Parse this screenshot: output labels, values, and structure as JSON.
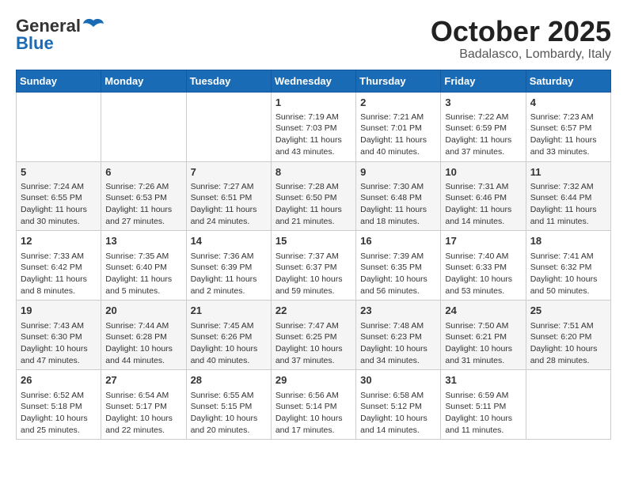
{
  "header": {
    "logo_general": "General",
    "logo_blue": "Blue",
    "month_year": "October 2025",
    "location": "Badalasco, Lombardy, Italy"
  },
  "days_of_week": [
    "Sunday",
    "Monday",
    "Tuesday",
    "Wednesday",
    "Thursday",
    "Friday",
    "Saturday"
  ],
  "weeks": [
    [
      {
        "day": "",
        "sunrise": "",
        "sunset": "",
        "daylight": ""
      },
      {
        "day": "",
        "sunrise": "",
        "sunset": "",
        "daylight": ""
      },
      {
        "day": "",
        "sunrise": "",
        "sunset": "",
        "daylight": ""
      },
      {
        "day": "1",
        "sunrise": "Sunrise: 7:19 AM",
        "sunset": "Sunset: 7:03 PM",
        "daylight": "Daylight: 11 hours and 43 minutes."
      },
      {
        "day": "2",
        "sunrise": "Sunrise: 7:21 AM",
        "sunset": "Sunset: 7:01 PM",
        "daylight": "Daylight: 11 hours and 40 minutes."
      },
      {
        "day": "3",
        "sunrise": "Sunrise: 7:22 AM",
        "sunset": "Sunset: 6:59 PM",
        "daylight": "Daylight: 11 hours and 37 minutes."
      },
      {
        "day": "4",
        "sunrise": "Sunrise: 7:23 AM",
        "sunset": "Sunset: 6:57 PM",
        "daylight": "Daylight: 11 hours and 33 minutes."
      }
    ],
    [
      {
        "day": "5",
        "sunrise": "Sunrise: 7:24 AM",
        "sunset": "Sunset: 6:55 PM",
        "daylight": "Daylight: 11 hours and 30 minutes."
      },
      {
        "day": "6",
        "sunrise": "Sunrise: 7:26 AM",
        "sunset": "Sunset: 6:53 PM",
        "daylight": "Daylight: 11 hours and 27 minutes."
      },
      {
        "day": "7",
        "sunrise": "Sunrise: 7:27 AM",
        "sunset": "Sunset: 6:51 PM",
        "daylight": "Daylight: 11 hours and 24 minutes."
      },
      {
        "day": "8",
        "sunrise": "Sunrise: 7:28 AM",
        "sunset": "Sunset: 6:50 PM",
        "daylight": "Daylight: 11 hours and 21 minutes."
      },
      {
        "day": "9",
        "sunrise": "Sunrise: 7:30 AM",
        "sunset": "Sunset: 6:48 PM",
        "daylight": "Daylight: 11 hours and 18 minutes."
      },
      {
        "day": "10",
        "sunrise": "Sunrise: 7:31 AM",
        "sunset": "Sunset: 6:46 PM",
        "daylight": "Daylight: 11 hours and 14 minutes."
      },
      {
        "day": "11",
        "sunrise": "Sunrise: 7:32 AM",
        "sunset": "Sunset: 6:44 PM",
        "daylight": "Daylight: 11 hours and 11 minutes."
      }
    ],
    [
      {
        "day": "12",
        "sunrise": "Sunrise: 7:33 AM",
        "sunset": "Sunset: 6:42 PM",
        "daylight": "Daylight: 11 hours and 8 minutes."
      },
      {
        "day": "13",
        "sunrise": "Sunrise: 7:35 AM",
        "sunset": "Sunset: 6:40 PM",
        "daylight": "Daylight: 11 hours and 5 minutes."
      },
      {
        "day": "14",
        "sunrise": "Sunrise: 7:36 AM",
        "sunset": "Sunset: 6:39 PM",
        "daylight": "Daylight: 11 hours and 2 minutes."
      },
      {
        "day": "15",
        "sunrise": "Sunrise: 7:37 AM",
        "sunset": "Sunset: 6:37 PM",
        "daylight": "Daylight: 10 hours and 59 minutes."
      },
      {
        "day": "16",
        "sunrise": "Sunrise: 7:39 AM",
        "sunset": "Sunset: 6:35 PM",
        "daylight": "Daylight: 10 hours and 56 minutes."
      },
      {
        "day": "17",
        "sunrise": "Sunrise: 7:40 AM",
        "sunset": "Sunset: 6:33 PM",
        "daylight": "Daylight: 10 hours and 53 minutes."
      },
      {
        "day": "18",
        "sunrise": "Sunrise: 7:41 AM",
        "sunset": "Sunset: 6:32 PM",
        "daylight": "Daylight: 10 hours and 50 minutes."
      }
    ],
    [
      {
        "day": "19",
        "sunrise": "Sunrise: 7:43 AM",
        "sunset": "Sunset: 6:30 PM",
        "daylight": "Daylight: 10 hours and 47 minutes."
      },
      {
        "day": "20",
        "sunrise": "Sunrise: 7:44 AM",
        "sunset": "Sunset: 6:28 PM",
        "daylight": "Daylight: 10 hours and 44 minutes."
      },
      {
        "day": "21",
        "sunrise": "Sunrise: 7:45 AM",
        "sunset": "Sunset: 6:26 PM",
        "daylight": "Daylight: 10 hours and 40 minutes."
      },
      {
        "day": "22",
        "sunrise": "Sunrise: 7:47 AM",
        "sunset": "Sunset: 6:25 PM",
        "daylight": "Daylight: 10 hours and 37 minutes."
      },
      {
        "day": "23",
        "sunrise": "Sunrise: 7:48 AM",
        "sunset": "Sunset: 6:23 PM",
        "daylight": "Daylight: 10 hours and 34 minutes."
      },
      {
        "day": "24",
        "sunrise": "Sunrise: 7:50 AM",
        "sunset": "Sunset: 6:21 PM",
        "daylight": "Daylight: 10 hours and 31 minutes."
      },
      {
        "day": "25",
        "sunrise": "Sunrise: 7:51 AM",
        "sunset": "Sunset: 6:20 PM",
        "daylight": "Daylight: 10 hours and 28 minutes."
      }
    ],
    [
      {
        "day": "26",
        "sunrise": "Sunrise: 6:52 AM",
        "sunset": "Sunset: 5:18 PM",
        "daylight": "Daylight: 10 hours and 25 minutes."
      },
      {
        "day": "27",
        "sunrise": "Sunrise: 6:54 AM",
        "sunset": "Sunset: 5:17 PM",
        "daylight": "Daylight: 10 hours and 22 minutes."
      },
      {
        "day": "28",
        "sunrise": "Sunrise: 6:55 AM",
        "sunset": "Sunset: 5:15 PM",
        "daylight": "Daylight: 10 hours and 20 minutes."
      },
      {
        "day": "29",
        "sunrise": "Sunrise: 6:56 AM",
        "sunset": "Sunset: 5:14 PM",
        "daylight": "Daylight: 10 hours and 17 minutes."
      },
      {
        "day": "30",
        "sunrise": "Sunrise: 6:58 AM",
        "sunset": "Sunset: 5:12 PM",
        "daylight": "Daylight: 10 hours and 14 minutes."
      },
      {
        "day": "31",
        "sunrise": "Sunrise: 6:59 AM",
        "sunset": "Sunset: 5:11 PM",
        "daylight": "Daylight: 10 hours and 11 minutes."
      },
      {
        "day": "",
        "sunrise": "",
        "sunset": "",
        "daylight": ""
      }
    ]
  ],
  "colors": {
    "header_bg": "#1a6bb5",
    "accent": "#1a6bb5"
  }
}
